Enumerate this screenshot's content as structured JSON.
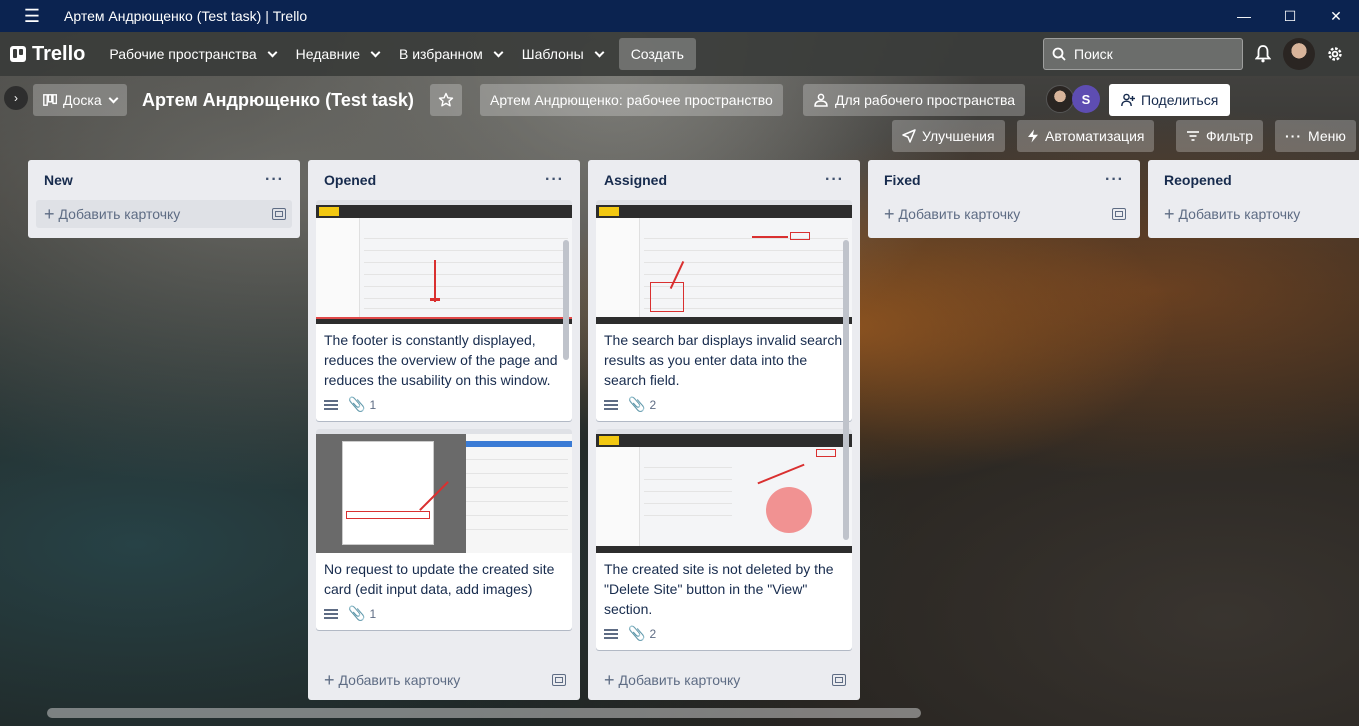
{
  "window": {
    "title": "Артем Андрющенко (Test task) | Trello",
    "controls": [
      "—",
      "☐",
      "✕"
    ]
  },
  "header": {
    "logo_text": "Trello",
    "menus": [
      {
        "label": "Рабочие пространства"
      },
      {
        "label": "Недавние"
      },
      {
        "label": "В избранном"
      },
      {
        "label": "Шаблоны"
      }
    ],
    "create_label": "Создать",
    "search_placeholder": "Поиск"
  },
  "board": {
    "view_label": "Доска",
    "title": "Артем Андрющенко (Test task)",
    "workspace_label": "Артем Андрющенко: рабочее пространство",
    "visibility_label": "Для рабочего пространства",
    "member_initial": "S",
    "share_label": "Поделиться",
    "powerups_label": "Улучшения",
    "automation_label": "Автоматизация",
    "filter_label": "Фильтр",
    "menu_label": "Меню"
  },
  "lists": [
    {
      "name": "New",
      "add_label": "Добавить карточку",
      "cards": []
    },
    {
      "name": "Opened",
      "add_label": "Добавить карточку",
      "cards": [
        {
          "title": "The footer is constantly displayed, reduces the overview of the page and reduces the usability on this window.",
          "attachments": "1"
        },
        {
          "title": "No request to update the created site card (edit input data, add images)",
          "attachments": "1"
        }
      ]
    },
    {
      "name": "Assigned",
      "add_label": "Добавить карточку",
      "cards": [
        {
          "title": "The search bar displays invalid search results as you enter data into the search field.",
          "attachments": "2"
        },
        {
          "title": "The created site is not deleted by the \"Delete Site\" button in the \"View\" section.",
          "attachments": "2"
        }
      ]
    },
    {
      "name": "Fixed",
      "add_label": "Добавить карточку",
      "cards": []
    },
    {
      "name": "Reopened",
      "add_label": "Добавить карточку",
      "cards": []
    }
  ]
}
